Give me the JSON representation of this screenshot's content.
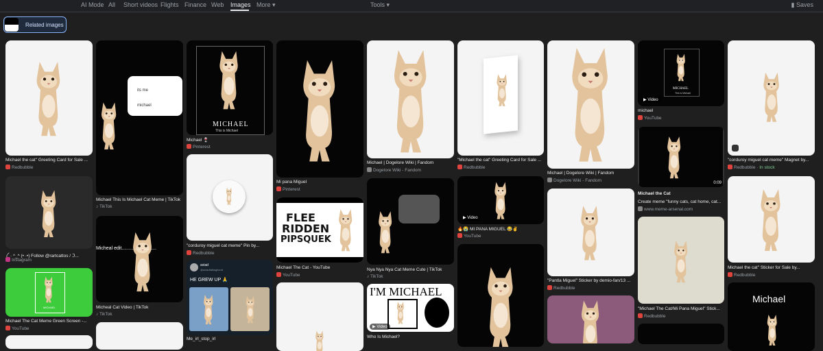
{
  "nav": {
    "tabs": [
      "AI Mode",
      "All",
      "Short videos",
      "Flights",
      "Finance",
      "Web",
      "Images",
      "More"
    ],
    "tools": "Tools",
    "saves": "Saves"
  },
  "related_images": "Related images",
  "cards": {
    "c1": {
      "caption": "Michael the cat\" Greeting Card for Sale ...",
      "source": "Redbubble"
    },
    "c2": {
      "caption": "༼ · ^_^ (• ·•) Follow @rartcattos / ℑ...",
      "source": "Instagram"
    },
    "c3": {
      "caption": "Michael The Cat Meme Green Screen -...",
      "source": "YouTube",
      "label": "MICHAEL"
    },
    "c4": {
      "caption": "Michael This Is Michael Cat Meme | TikTok",
      "source": "TikTok",
      "bubble_text": [
        "its me",
        "michael"
      ]
    },
    "c5": {
      "caption": "Micheal Cat Video | TikTok",
      "source": "TikTok",
      "overlay": "Micheal edit.........................."
    },
    "c6": {
      "caption": "Michael 🍷",
      "source": "Pinterest",
      "title": "MICHAEL",
      "subtitle": "This is Michael"
    },
    "c7": {
      "caption": "\"corduroy miguel cat meme\" Pin by...",
      "source": "Redbubble"
    },
    "c8": {
      "caption": "Me_irl_stop_irl",
      "source": "",
      "tweet_name": "aviad",
      "tweet_handle": "@aviadtalksghood",
      "tweet_text": "HE GREW UP 🙏"
    },
    "c9": {
      "caption": "Mi pana Miguel",
      "source": "Pinterest"
    },
    "c10": {
      "caption": "Michael The Cat - YouTube",
      "source": "YouTube",
      "text": [
        "FLEE",
        "RIDDEN",
        "PIPSQUEK"
      ]
    },
    "c11": {
      "caption": "Michael | Dogelore Wiki | Fandom",
      "source": "Dogelore Wiki - Fandom"
    },
    "c12": {
      "caption": "Nya Nya Nya Cat Meme Cute | TikTok",
      "source": "TikTok"
    },
    "c13": {
      "caption": "Who Is Michael?",
      "source": "",
      "title": "I'M MICHAEL",
      "video": "Video"
    },
    "c14": {
      "caption": "\"Michael the cat\" Greeting Card for Sale ...",
      "source": "Redbubble"
    },
    "c15": {
      "caption": "🔥😭 MI PANA MIGUEL 😂✌",
      "source": "YouTube",
      "video": "Video"
    },
    "c16": {
      "caption": "Michael | Dogelore Wiki | Fandom",
      "source": "Dogelore Wiki - Fandom"
    },
    "c17": {
      "caption": "\"Pantla Miguel\" Sticker by demio-fan/13 ...",
      "source": "Redbubble"
    },
    "c18": {
      "caption": "michael",
      "source": "YouTube",
      "video": "Video",
      "title": "MICHAEL",
      "subtitle": "This is Michael"
    },
    "c19": {
      "caption": "Michael the Cat",
      "caption2": "Create meme \"funny cats, cat home, cat...",
      "source": "www.meme-arsenal.com",
      "time": "0:09"
    },
    "c20": {
      "caption": "\"Michael The Cat/Mi Pana Miguel\" Stick...",
      "source": "Redbubble"
    },
    "c21": {
      "caption": "\"corduroy miguel cat meme\" Magnet by...",
      "source": "Redbubble",
      "stock": "In stock"
    },
    "c22": {
      "caption": "Michael the cat\" Sticker for Sale by...",
      "source": "Redbubble"
    },
    "c23": {
      "label": "Michael"
    }
  }
}
